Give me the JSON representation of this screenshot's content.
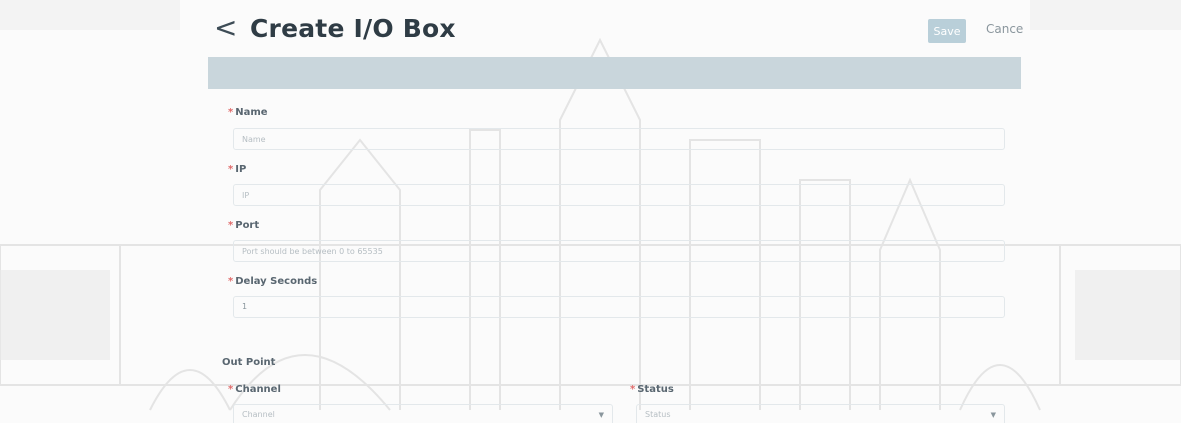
{
  "header": {
    "back_glyph": "<",
    "title": "Create I/O Box",
    "save_label": "Save",
    "cancel_label": "Cancel"
  },
  "form": {
    "name": {
      "label": "Name",
      "placeholder": "Name",
      "required": true
    },
    "ip": {
      "label": "IP",
      "placeholder": "IP",
      "required": true
    },
    "port": {
      "label": "Port",
      "placeholder": "Port should be between 0 to 65535",
      "required": true
    },
    "delay": {
      "label": "Delay Seconds",
      "value": "1",
      "required": true
    },
    "out_point": {
      "label": "Out Point"
    },
    "channel": {
      "label": "Channel",
      "placeholder": "Channel",
      "required": true
    },
    "status": {
      "label": "Status",
      "placeholder": "Status",
      "required": true
    }
  },
  "required_marker": "*",
  "colors": {
    "title": "#2f3c45",
    "banner": "#c9d6dc",
    "save_button": "#b9cfd9",
    "required": "#e06a6a"
  },
  "icons": {
    "back": "chevron-left-icon",
    "dropdown": "chevron-down-icon"
  }
}
